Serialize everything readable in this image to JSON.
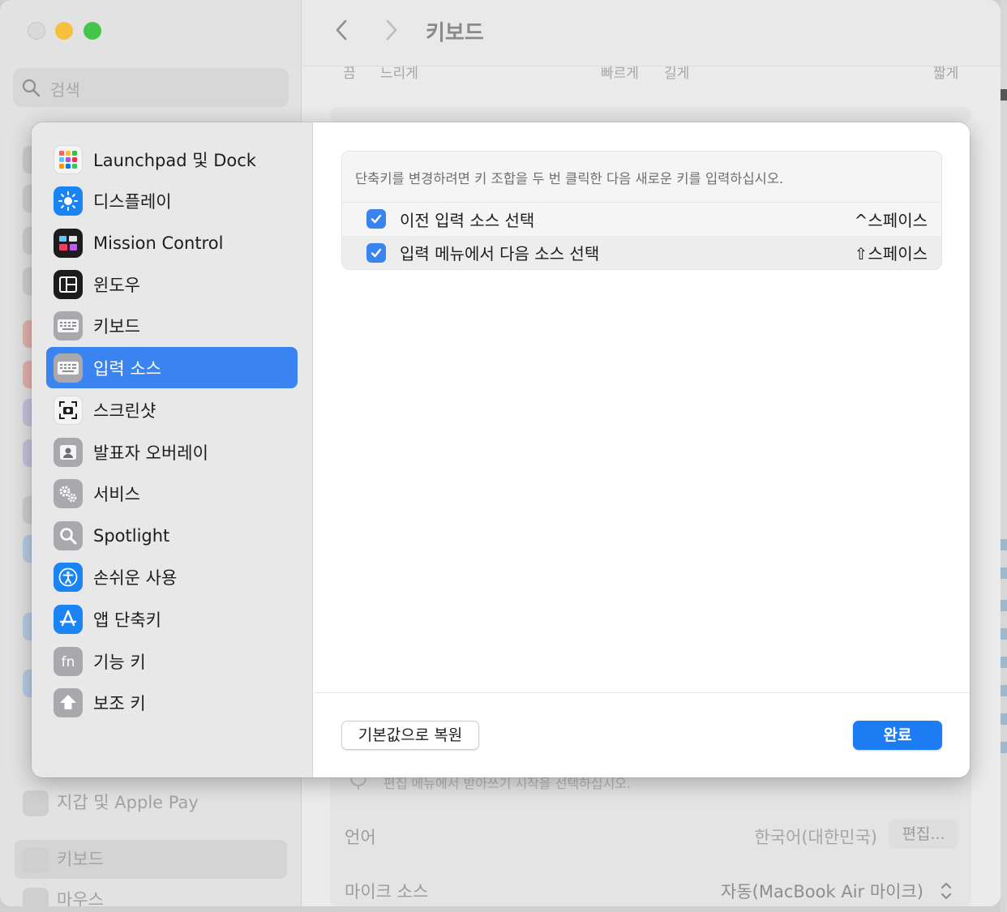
{
  "window": {
    "title": "키보드",
    "search_placeholder": "검색",
    "bg_sidebar": {
      "wallet_label": "지갑 및 Apple Pay",
      "keyboard_label": "키보드",
      "mouse_label": "마우스"
    },
    "bg_slider_labels": {
      "left_1": "끔",
      "left_2": "느리게",
      "mid_1": "빠르게",
      "mid_2": "길게",
      "right": "짧게"
    },
    "bg_rows": {
      "dictation_hint": "편집 메뉴에서 받아쓰기 시작을 선택하십시오.",
      "language_label": "언어",
      "language_value": "한국어(대한민국)",
      "edit_button": "편집...",
      "mic_label": "마이크 소스",
      "mic_value": "자동(MacBook Air 마이크)"
    }
  },
  "sheet": {
    "sidebar": {
      "items": [
        {
          "label": "Launchpad 및 Dock",
          "icon": "launchpad-icon",
          "selected": false
        },
        {
          "label": "디스플레이",
          "icon": "display-icon",
          "selected": false
        },
        {
          "label": "Mission Control",
          "icon": "mission-control-icon",
          "selected": false
        },
        {
          "label": "윈도우",
          "icon": "windows-icon",
          "selected": false
        },
        {
          "label": "키보드",
          "icon": "keyboard-icon",
          "selected": false
        },
        {
          "label": "입력 소스",
          "icon": "input-sources-icon",
          "selected": true
        },
        {
          "label": "스크린샷",
          "icon": "screenshot-icon",
          "selected": false
        },
        {
          "label": "발표자 오버레이",
          "icon": "presenter-overlay-icon",
          "selected": false
        },
        {
          "label": "서비스",
          "icon": "services-icon",
          "selected": false
        },
        {
          "label": "Spotlight",
          "icon": "spotlight-icon",
          "selected": false
        },
        {
          "label": "손쉬운 사용",
          "icon": "accessibility-icon",
          "selected": false
        },
        {
          "label": "앱 단축키",
          "icon": "app-shortcuts-icon",
          "selected": false
        },
        {
          "label": "기능 키",
          "icon": "function-keys-icon",
          "selected": false
        },
        {
          "label": "보조 키",
          "icon": "modifier-keys-icon",
          "selected": false
        }
      ]
    },
    "hint": "단축키를 변경하려면 키 조합을 두 번 클릭한 다음 새로운 키를 입력하십시오.",
    "shortcuts": [
      {
        "label": "이전 입력 소스 선택",
        "keys": "^스페이스",
        "checked": true
      },
      {
        "label": "입력 메뉴에서 다음 소스 선택",
        "keys": "⇧스페이스",
        "checked": true
      }
    ],
    "restore_button": "기본값으로 복원",
    "done_button": "완료",
    "colors": {
      "accent": "#3a84f2",
      "done": "#1e7cf2"
    }
  }
}
